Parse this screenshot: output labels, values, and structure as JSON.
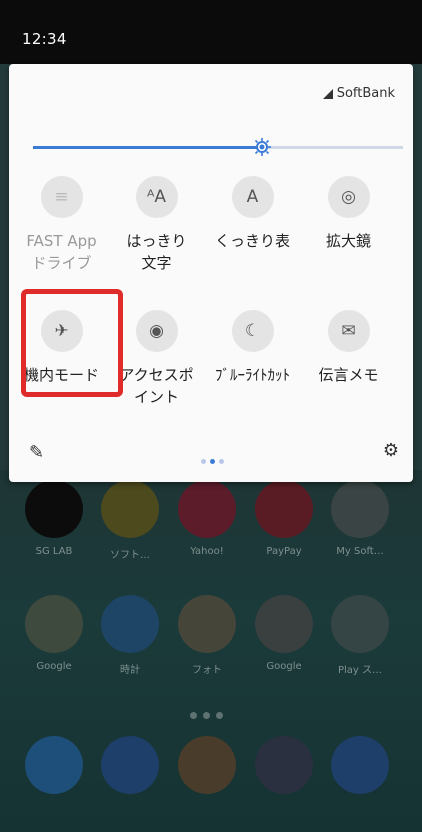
{
  "status": {
    "time": "12:34"
  },
  "panel": {
    "carrier": "SoftBank",
    "brightness": 0.62,
    "tiles": [
      {
        "label": "FAST App\nドライブ",
        "icon": "fast-app-drive-icon",
        "glyph": "≡",
        "dim": true
      },
      {
        "label": "はっきり\n文字",
        "icon": "clear-text-icon",
        "glyph": "ᴬA",
        "dim": false
      },
      {
        "label": "くっきり表",
        "icon": "sharp-display-icon",
        "glyph": "A",
        "dim": false
      },
      {
        "label": "拡大鏡",
        "icon": "magnifier-icon",
        "glyph": "◎",
        "dim": false
      },
      {
        "label": "機内モード",
        "icon": "airplane-icon",
        "glyph": "✈",
        "dim": false
      },
      {
        "label": "アクセスポ\nイント",
        "icon": "hotspot-icon",
        "glyph": "◉",
        "dim": false
      },
      {
        "label": "ﾌﾞﾙｰﾗｲﾄｶｯﾄ",
        "icon": "blue-light-cut-icon",
        "glyph": "☾",
        "dim": false
      },
      {
        "label": "伝言メモ",
        "icon": "voicemail-memo-icon",
        "glyph": "✉",
        "dim": false
      }
    ],
    "page_index": 1,
    "page_count": 3
  },
  "home": {
    "row1": [
      {
        "label": "SG LAB",
        "color": "#0c0c0c"
      },
      {
        "label": "ソフト…",
        "color": "#4d4a1e"
      },
      {
        "label": "Yahoo!",
        "color": "#5c1c2a"
      },
      {
        "label": "PayPay",
        "color": "#5a1c24"
      },
      {
        "label": "My Soft…",
        "color": "#3a4444"
      }
    ],
    "row2": [
      {
        "label": "Google",
        "color": "#3f4a3f"
      },
      {
        "label": "時計",
        "color": "#1f4566"
      },
      {
        "label": "フォト",
        "color": "#45453a"
      },
      {
        "label": "Google",
        "color": "#3a3f3f"
      },
      {
        "label": "Play ス…",
        "color": "#354545"
      }
    ],
    "dock": [
      {
        "name": "phone",
        "color": "#1e4f7a"
      },
      {
        "name": "message",
        "color": "#1e3f6a"
      },
      {
        "name": "chrome",
        "color": "#4a3c2a"
      },
      {
        "name": "camera",
        "color": "#2a3040"
      },
      {
        "name": "settings",
        "color": "#1e3f6a"
      }
    ]
  }
}
